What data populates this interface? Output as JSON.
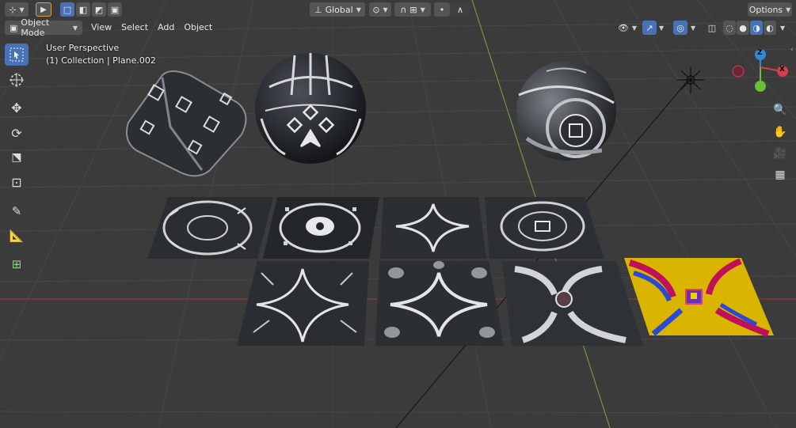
{
  "header": {
    "orientation": "Global",
    "options_label": "Options",
    "mode_label": "Object Mode",
    "menus": [
      "View",
      "Select",
      "Add",
      "Object"
    ]
  },
  "overlay": {
    "view_name": "User Perspective",
    "collection_info": "(1) Collection | Plane.002"
  },
  "gizmo": {
    "z": "Z",
    "x": "X"
  },
  "colors": {
    "accent": "#4772b3",
    "x_axis": "#d2404f",
    "y_axis": "#6bbf33",
    "z_axis": "#2c8ddb",
    "bg": "#3b3b3b"
  },
  "toolbar_icons": [
    "select-box-icon",
    "cursor-icon",
    "move-icon",
    "rotate-icon",
    "scale-icon",
    "transform-icon",
    "annotate-icon",
    "measure-icon",
    "add-cube-icon"
  ],
  "nav_icons": [
    "zoom-icon",
    "pan-hand-icon",
    "camera-icon",
    "grid-view-icon"
  ]
}
